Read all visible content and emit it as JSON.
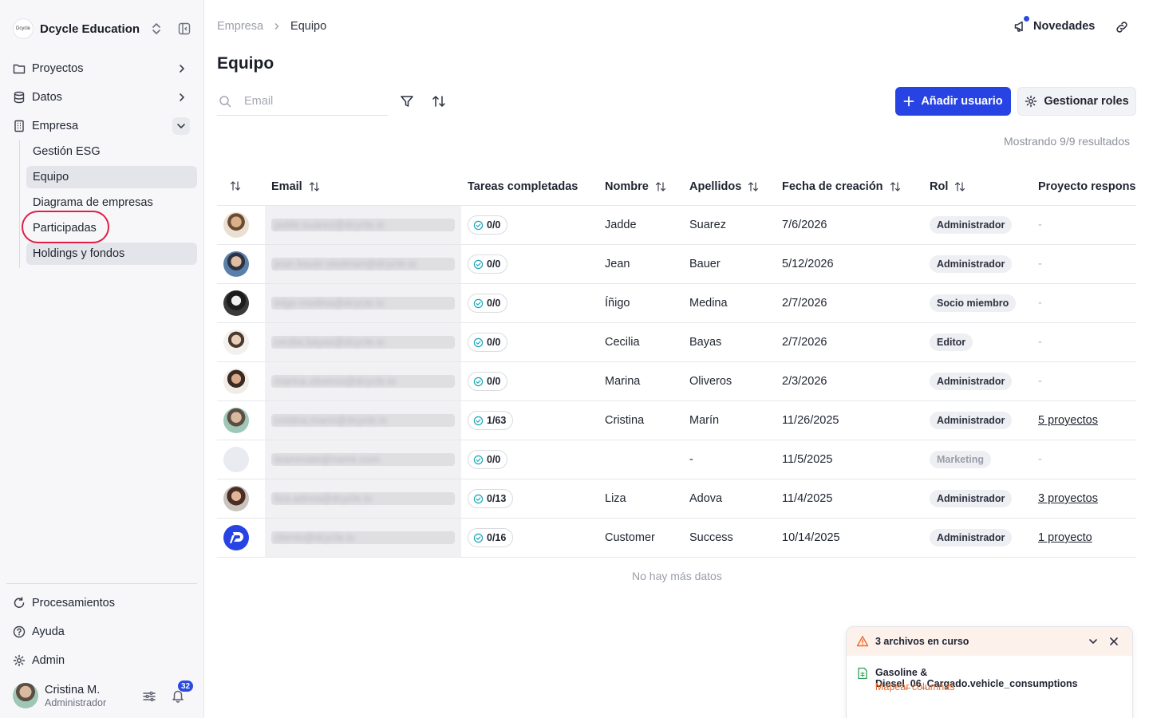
{
  "sidebar": {
    "brand_logo_text": "Dcycle",
    "brand_name": "Dcycle Education",
    "items": [
      {
        "label": "Proyectos",
        "icon": "folder-icon"
      },
      {
        "label": "Datos",
        "icon": "database-icon"
      },
      {
        "label": "Empresa",
        "icon": "building-icon"
      }
    ],
    "subitems": [
      "Gestión ESG",
      "Equipo",
      "Diagrama de empresas",
      "Participadas",
      "Holdings y fondos"
    ],
    "bottom_items": [
      {
        "label": "Procesamientos",
        "icon": "refresh-icon"
      },
      {
        "label": "Ayuda",
        "icon": "help-icon"
      },
      {
        "label": "Admin",
        "icon": "gear-icon"
      }
    ],
    "user": {
      "name": "Cristina M.",
      "role": "Administrador",
      "notifications": "32"
    }
  },
  "header": {
    "breadcrumb": [
      "Empresa",
      "Equipo"
    ],
    "news_label": "Novedades"
  },
  "page": {
    "title": "Equipo",
    "search_placeholder": "Email",
    "add_user_label": "Añadir usuario",
    "manage_roles_label": "Gestionar roles",
    "results_text": "Mostrando 9/9 resultados",
    "end_note": "No hay más datos"
  },
  "table": {
    "columns": [
      "Email",
      "Tareas completadas",
      "Nombre",
      "Apellidos",
      "Fecha de creación",
      "Rol",
      "Proyecto responsable"
    ],
    "rows": [
      {
        "email": "jadde.suarez@dcycle.io",
        "tasks": "0/0",
        "nombre": "Jadde",
        "apellidos": "Suarez",
        "fecha": "7/6/2026",
        "rol": "Administrador",
        "proyecto": "-"
      },
      {
        "email": "jean.bauer.stedman@dcycle.io",
        "tasks": "0/0",
        "nombre": "Jean",
        "apellidos": "Bauer",
        "fecha": "5/12/2026",
        "rol": "Administrador",
        "proyecto": "-"
      },
      {
        "email": "inigo.medina@dcycle.io",
        "tasks": "0/0",
        "nombre": "Íñigo",
        "apellidos": "Medina",
        "fecha": "2/7/2026",
        "rol": "Socio miembro",
        "proyecto": "-"
      },
      {
        "email": "cecilia.bayas@dcycle.io",
        "tasks": "0/0",
        "nombre": "Cecilia",
        "apellidos": "Bayas",
        "fecha": "2/7/2026",
        "rol": "Editor",
        "proyecto": "-"
      },
      {
        "email": "marina.oliveros@dcycle.io",
        "tasks": "0/0",
        "nombre": "Marina",
        "apellidos": "Oliveros",
        "fecha": "2/3/2026",
        "rol": "Administrador",
        "proyecto": "-"
      },
      {
        "email": "cristina.marin@dcycle.io",
        "tasks": "1/63",
        "nombre": "Cristina",
        "apellidos": "Marín",
        "fecha": "11/26/2025",
        "rol": "Administrador",
        "proyecto": "5 proyectos"
      },
      {
        "email": "teammate@name.com",
        "tasks": "0/0",
        "nombre": "",
        "apellidos": "-",
        "fecha": "11/5/2025",
        "rol": "Marketing",
        "proyecto": "-"
      },
      {
        "email": "liza.adova@dcycle.io",
        "tasks": "0/13",
        "nombre": "Liza",
        "apellidos": "Adova",
        "fecha": "11/4/2025",
        "rol": "Administrador",
        "proyecto": "3 proyectos"
      },
      {
        "email": "clients@dcycle.io",
        "tasks": "0/16",
        "nombre": "Customer",
        "apellidos": "Success",
        "fecha": "10/14/2025",
        "rol": "Administrador",
        "proyecto": "1 proyecto"
      }
    ]
  },
  "toast": {
    "title": "3 archivos en curso",
    "filename": "Gasoline & Diesel_06_Cargado.vehicle_consumptions",
    "action": "Mapear columnas"
  },
  "colors": {
    "accent": "#2743e3",
    "highlight": "#e11d48",
    "warning": "#f06a28"
  }
}
